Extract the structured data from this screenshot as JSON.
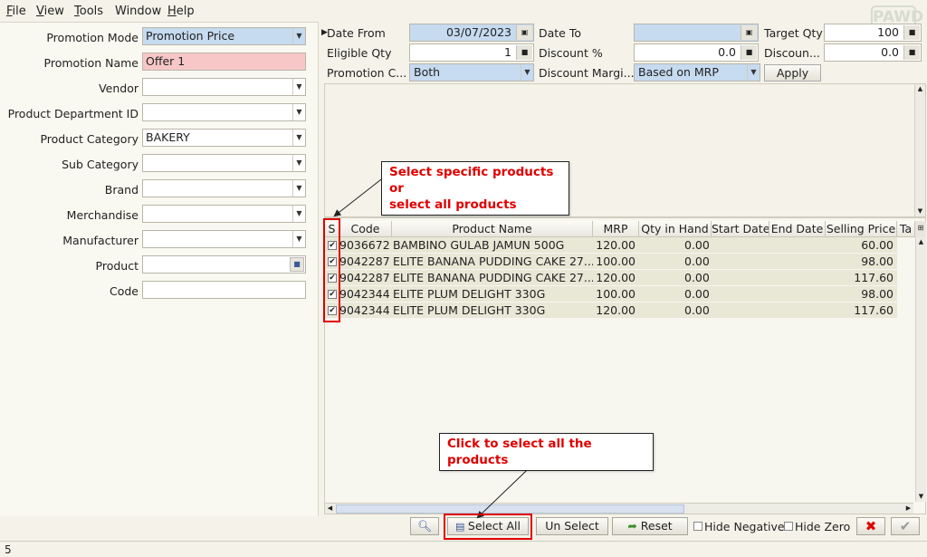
{
  "menu": [
    "File",
    "View",
    "Tools",
    "Window",
    "Help"
  ],
  "logo_text": "PAWD",
  "left_form": {
    "promotion_mode": {
      "label": "Promotion Mode",
      "value": "Promotion Price"
    },
    "promotion_name": {
      "label": "Promotion Name",
      "value": "Offer 1"
    },
    "vendor": {
      "label": "Vendor",
      "value": ""
    },
    "product_department_id": {
      "label": "Product Department ID",
      "value": ""
    },
    "product_category": {
      "label": "Product Category",
      "value": "BAKERY"
    },
    "sub_category": {
      "label": "Sub Category",
      "value": ""
    },
    "brand": {
      "label": "Brand",
      "value": ""
    },
    "merchandise": {
      "label": "Merchandise",
      "value": ""
    },
    "manufacturer": {
      "label": "Manufacturer",
      "value": ""
    },
    "product": {
      "label": "Product",
      "value": ""
    },
    "code": {
      "label": "Code",
      "value": ""
    }
  },
  "top_filters": {
    "date_from": {
      "label": "Date From",
      "value": "03/07/2023"
    },
    "date_to": {
      "label": "Date To",
      "value": ""
    },
    "target_qty": {
      "label": "Target Qty",
      "value": "100"
    },
    "eligible_qty": {
      "label": "Eligible Qty",
      "value": "1"
    },
    "discount_pct": {
      "label": "Discount %",
      "value": "0.0"
    },
    "discount_amt": {
      "label": "Discoun...",
      "value": "0.0"
    },
    "promotion_c": {
      "label": "Promotion C...",
      "value": "Both"
    },
    "discount_margin": {
      "label": "Discount Margi...",
      "value": "Based on MRP"
    },
    "apply_label": "Apply"
  },
  "grid": {
    "columns": [
      "S",
      "Code",
      "Product Name",
      "MRP",
      "Qty in Hand",
      "Start Date",
      "End Date",
      "Selling Price",
      "Ta"
    ],
    "rows": [
      {
        "checked": "✔",
        "code": "9036672",
        "name": "BAMBINO GULAB JAMUN 500G",
        "mrp": "120.00",
        "qty": "0.00",
        "start": "",
        "end": "",
        "price": "60.00"
      },
      {
        "checked": "✔",
        "code": "9042287",
        "name": "ELITE BANANA PUDDING CAKE 27...",
        "mrp": "100.00",
        "qty": "0.00",
        "start": "",
        "end": "",
        "price": "98.00"
      },
      {
        "checked": "✔",
        "code": "9042287",
        "name": "ELITE BANANA PUDDING CAKE 27...",
        "mrp": "120.00",
        "qty": "0.00",
        "start": "",
        "end": "",
        "price": "117.60"
      },
      {
        "checked": "✔",
        "code": "9042344",
        "name": "ELITE PLUM DELIGHT 330G",
        "mrp": "100.00",
        "qty": "0.00",
        "start": "",
        "end": "",
        "price": "98.00"
      },
      {
        "checked": "✔",
        "code": "9042344",
        "name": "ELITE PLUM DELIGHT 330G",
        "mrp": "120.00",
        "qty": "0.00",
        "start": "",
        "end": "",
        "price": "117.60"
      }
    ]
  },
  "toolbar": {
    "select_all": "Select All",
    "un_select": "Un Select",
    "reset": "Reset",
    "hide_negative": "Hide Negative",
    "hide_zero": "Hide Zero"
  },
  "status": {
    "count": "5"
  },
  "annotations": {
    "select_specific": [
      "Select specific products or",
      "select all products"
    ],
    "click_select_all": "Click to select all the products"
  },
  "colors": {
    "accent_red": "#e00000",
    "field_blue": "#c6daf0",
    "field_pink": "#f7c7c7"
  }
}
